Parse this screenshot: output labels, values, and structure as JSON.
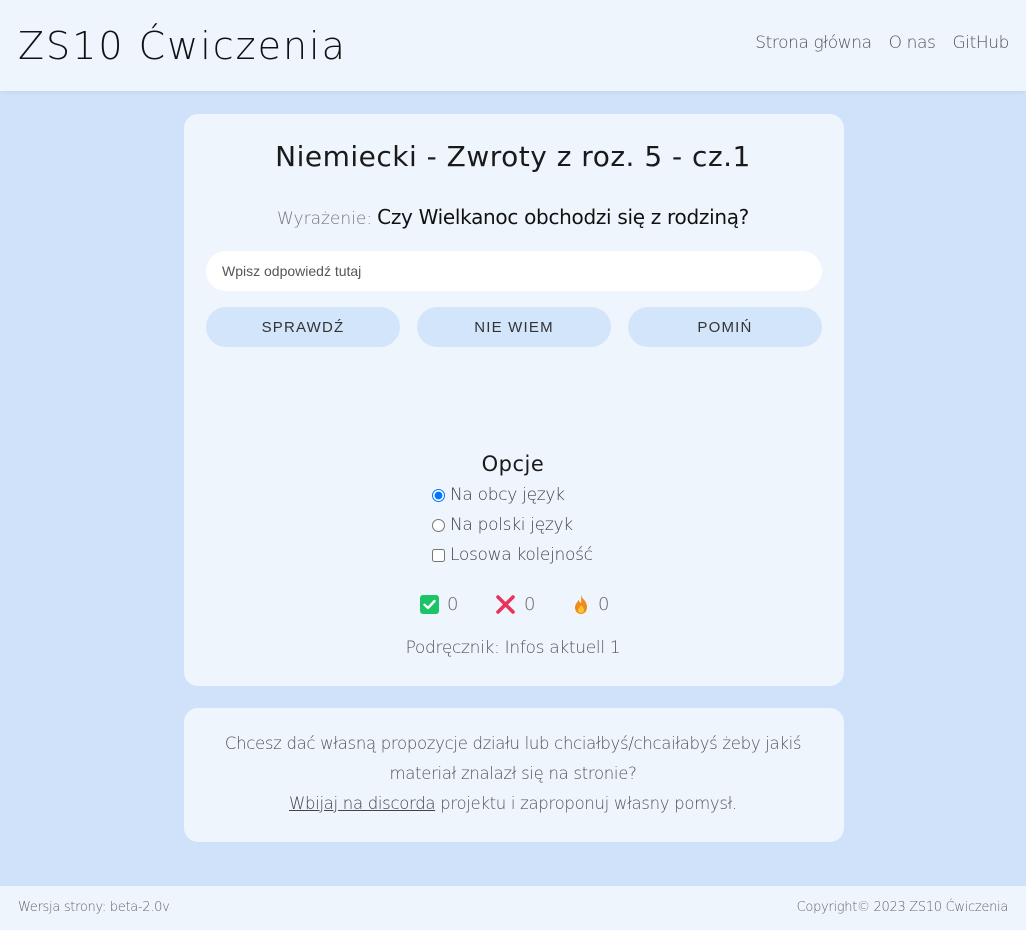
{
  "header": {
    "brand": "ZS10 Ćwiczenia",
    "nav": [
      "Strona główna",
      "O nas",
      "GitHub"
    ]
  },
  "exercise": {
    "title": "Niemiecki - Zwroty z roz. 5 - cz.1",
    "expression_label": "Wyrażenie:",
    "expression": "Czy Wielkanoc obchodzi się z rodziną?",
    "answer_placeholder": "Wpisz odpowiedź tutaj",
    "buttons": {
      "check": "SPRAWDŹ",
      "dont_know": "NIE WIEM",
      "skip": "POMIŃ"
    }
  },
  "options": {
    "title": "Opcje",
    "to_foreign": "Na obcy język",
    "to_polish": "Na polski język",
    "random_order": "Losowa kolejność",
    "selected": "to_foreign"
  },
  "stats": {
    "correct": "0",
    "wrong": "0",
    "streak": "0",
    "colors": {
      "correct": "#1bc466",
      "wrong": "#e8335a",
      "streak": "#f08a1c"
    }
  },
  "textbook": "Podręcznik: Infos aktuell 1",
  "info": {
    "line1": "Chcesz dać własną propozycje działu lub chciałbyś/chcaiłabyś żeby jakiś",
    "line2": "materiał znalazł się na stronie?",
    "link": "Wbijaj na discorda",
    "line3_rest": " projektu i zaproponuj własny pomysł."
  },
  "footer": {
    "version": "Wersja strony: beta-2.0v",
    "copyright": "Copyright© 2023 ZS10 Ćwiczenia"
  }
}
